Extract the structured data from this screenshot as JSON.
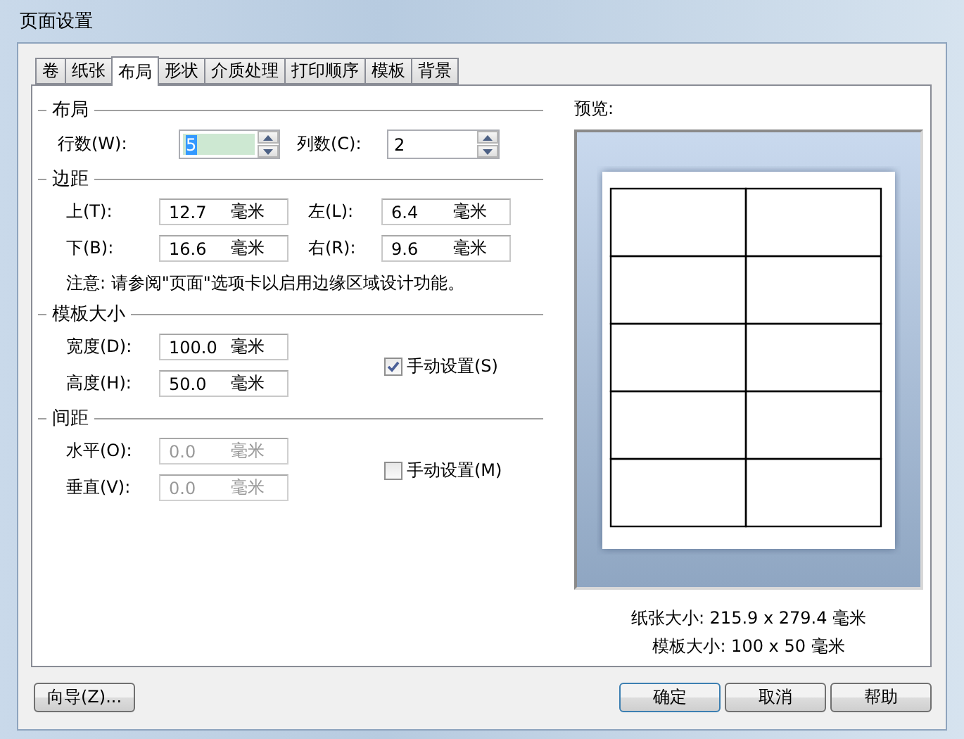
{
  "window": {
    "title": "页面设置"
  },
  "tabs": [
    {
      "label": "卷",
      "selected": false
    },
    {
      "label": "纸张",
      "selected": false
    },
    {
      "label": "布局",
      "selected": true
    },
    {
      "label": "形状",
      "selected": false
    },
    {
      "label": "介质处理",
      "selected": false
    },
    {
      "label": "打印顺序",
      "selected": false
    },
    {
      "label": "模板",
      "selected": false
    },
    {
      "label": "背景",
      "selected": false
    }
  ],
  "layout": {
    "heading": "布局",
    "spinners": [
      {
        "label": "行数(W):",
        "value": "5",
        "highlighted": true
      },
      {
        "label": "列数(C):",
        "value": "2",
        "highlighted": false
      }
    ]
  },
  "margins": {
    "heading": "边距",
    "fields": [
      {
        "label": "上(T):",
        "value": "12.7",
        "unit": "毫米"
      },
      {
        "label": "左(L):",
        "value": "6.4",
        "unit": "毫米"
      },
      {
        "label": "下(B):",
        "value": "16.6",
        "unit": "毫米"
      },
      {
        "label": "右(R):",
        "value": "9.6",
        "unit": "毫米"
      }
    ],
    "note": "注意: 请参阅\"页面\"选项卡以启用边缘区域设计功能。"
  },
  "label_size": {
    "heading": "模板大小",
    "fields": [
      {
        "label": "宽度(D):",
        "value": "100.0",
        "unit": "毫米",
        "disabled": false
      },
      {
        "label": "高度(H):",
        "value": "50.0",
        "unit": "毫米",
        "disabled": false
      }
    ],
    "manual": {
      "label": "手动设置(S)",
      "checked": true
    }
  },
  "spacing": {
    "heading": "间距",
    "fields": [
      {
        "label": "水平(O):",
        "value": "0.0",
        "unit": "毫米",
        "disabled": true
      },
      {
        "label": "垂直(V):",
        "value": "0.0",
        "unit": "毫米",
        "disabled": true
      }
    ],
    "manual": {
      "label": "手动设置(M)",
      "checked": false
    }
  },
  "preview": {
    "label": "预览:",
    "paper_size": "纸张大小: 215.9 x 279.4 毫米",
    "label_size": "模板大小: 100 x 50 毫米"
  },
  "buttons": {
    "wizard": "向导(Z)...",
    "ok": "确定",
    "cancel": "取消",
    "help": "帮助"
  }
}
